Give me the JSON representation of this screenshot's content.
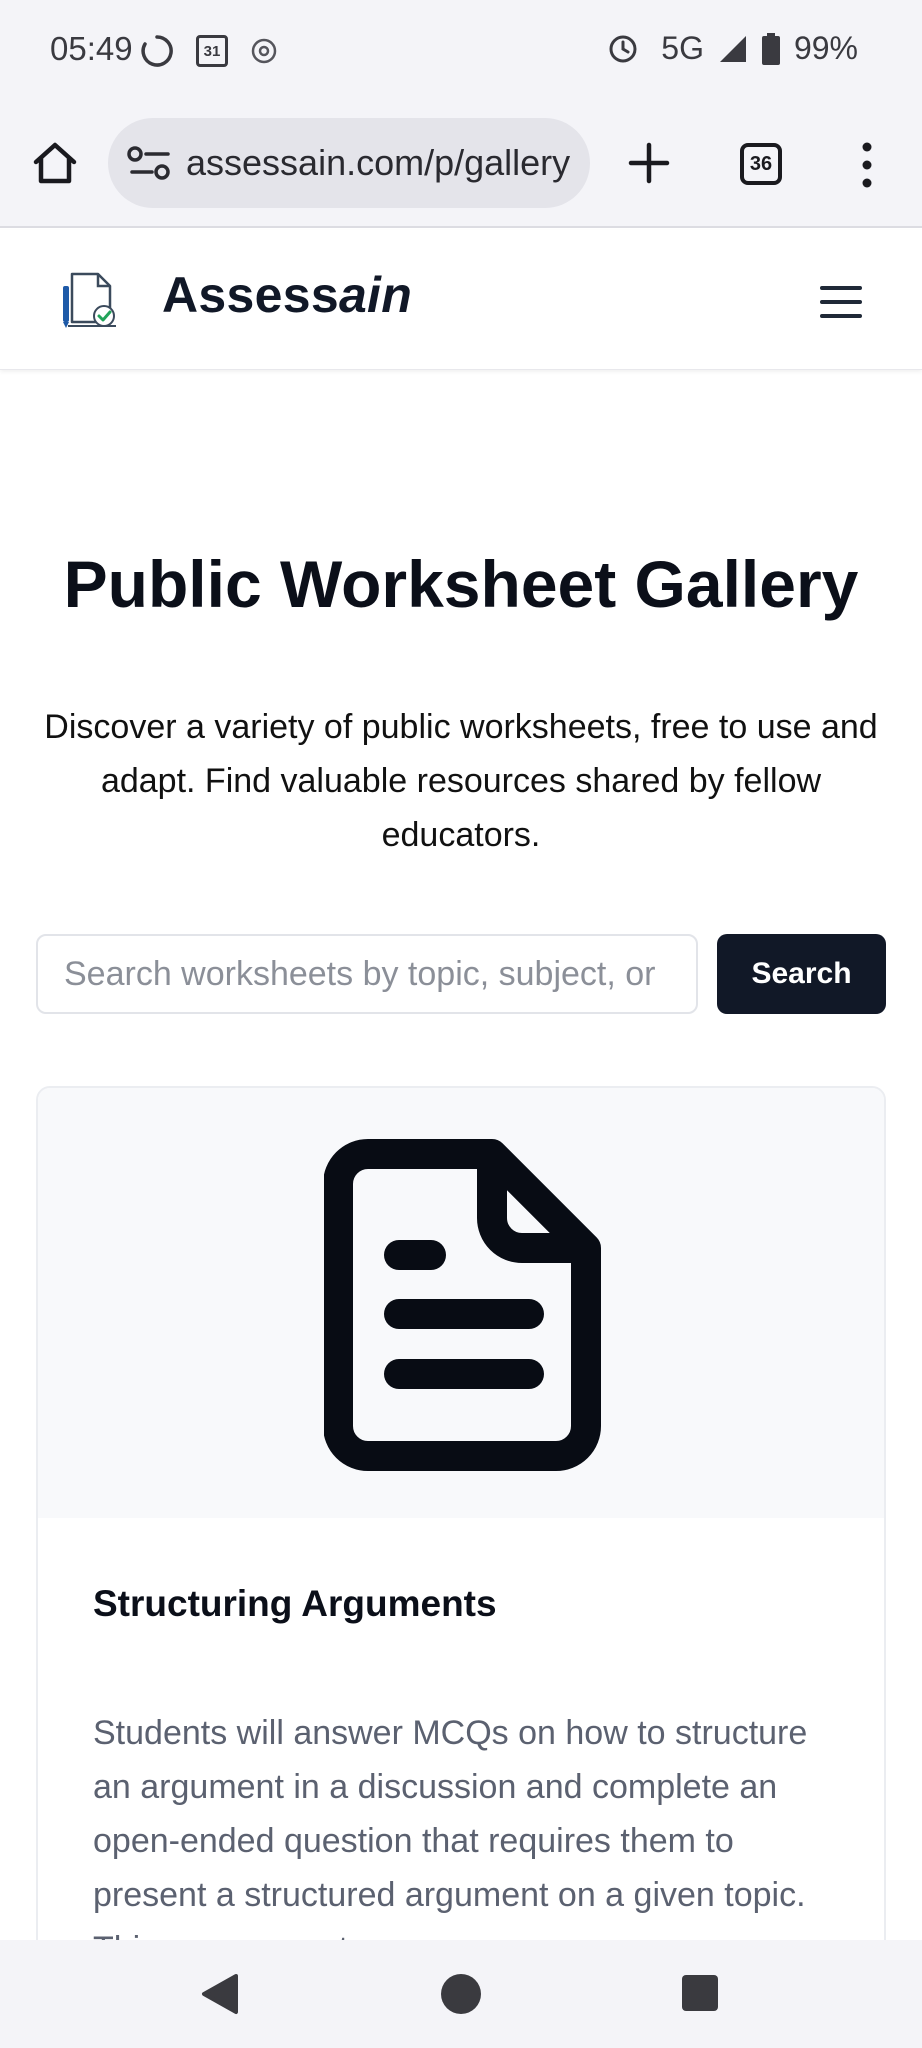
{
  "status_bar": {
    "time": "05:49",
    "calendar_day": "31",
    "network": "5G",
    "battery": "99%"
  },
  "browser": {
    "url": "assessain.com/p/gallery",
    "tab_count": "36"
  },
  "site": {
    "brand_prefix": "Assess",
    "brand_suffix": "ain"
  },
  "hero": {
    "title": "Public Worksheet Gallery",
    "description": "Discover a variety of public worksheets, free to use and adapt. Find valuable resources shared by fellow educators."
  },
  "search": {
    "placeholder": "Search worksheets by topic, subject, or",
    "button_label": "Search"
  },
  "worksheets": [
    {
      "title": "Structuring Arguments",
      "description": "Students will answer MCQs on how to structure an argument in a discussion and complete an open-ended question that requires them to present a structured argument on a given topic. This assessment",
      "icon": "document-icon"
    }
  ],
  "colors": {
    "primary_button": "#111827",
    "text_dark": "#0b0f19",
    "text_muted": "#5b6170"
  }
}
